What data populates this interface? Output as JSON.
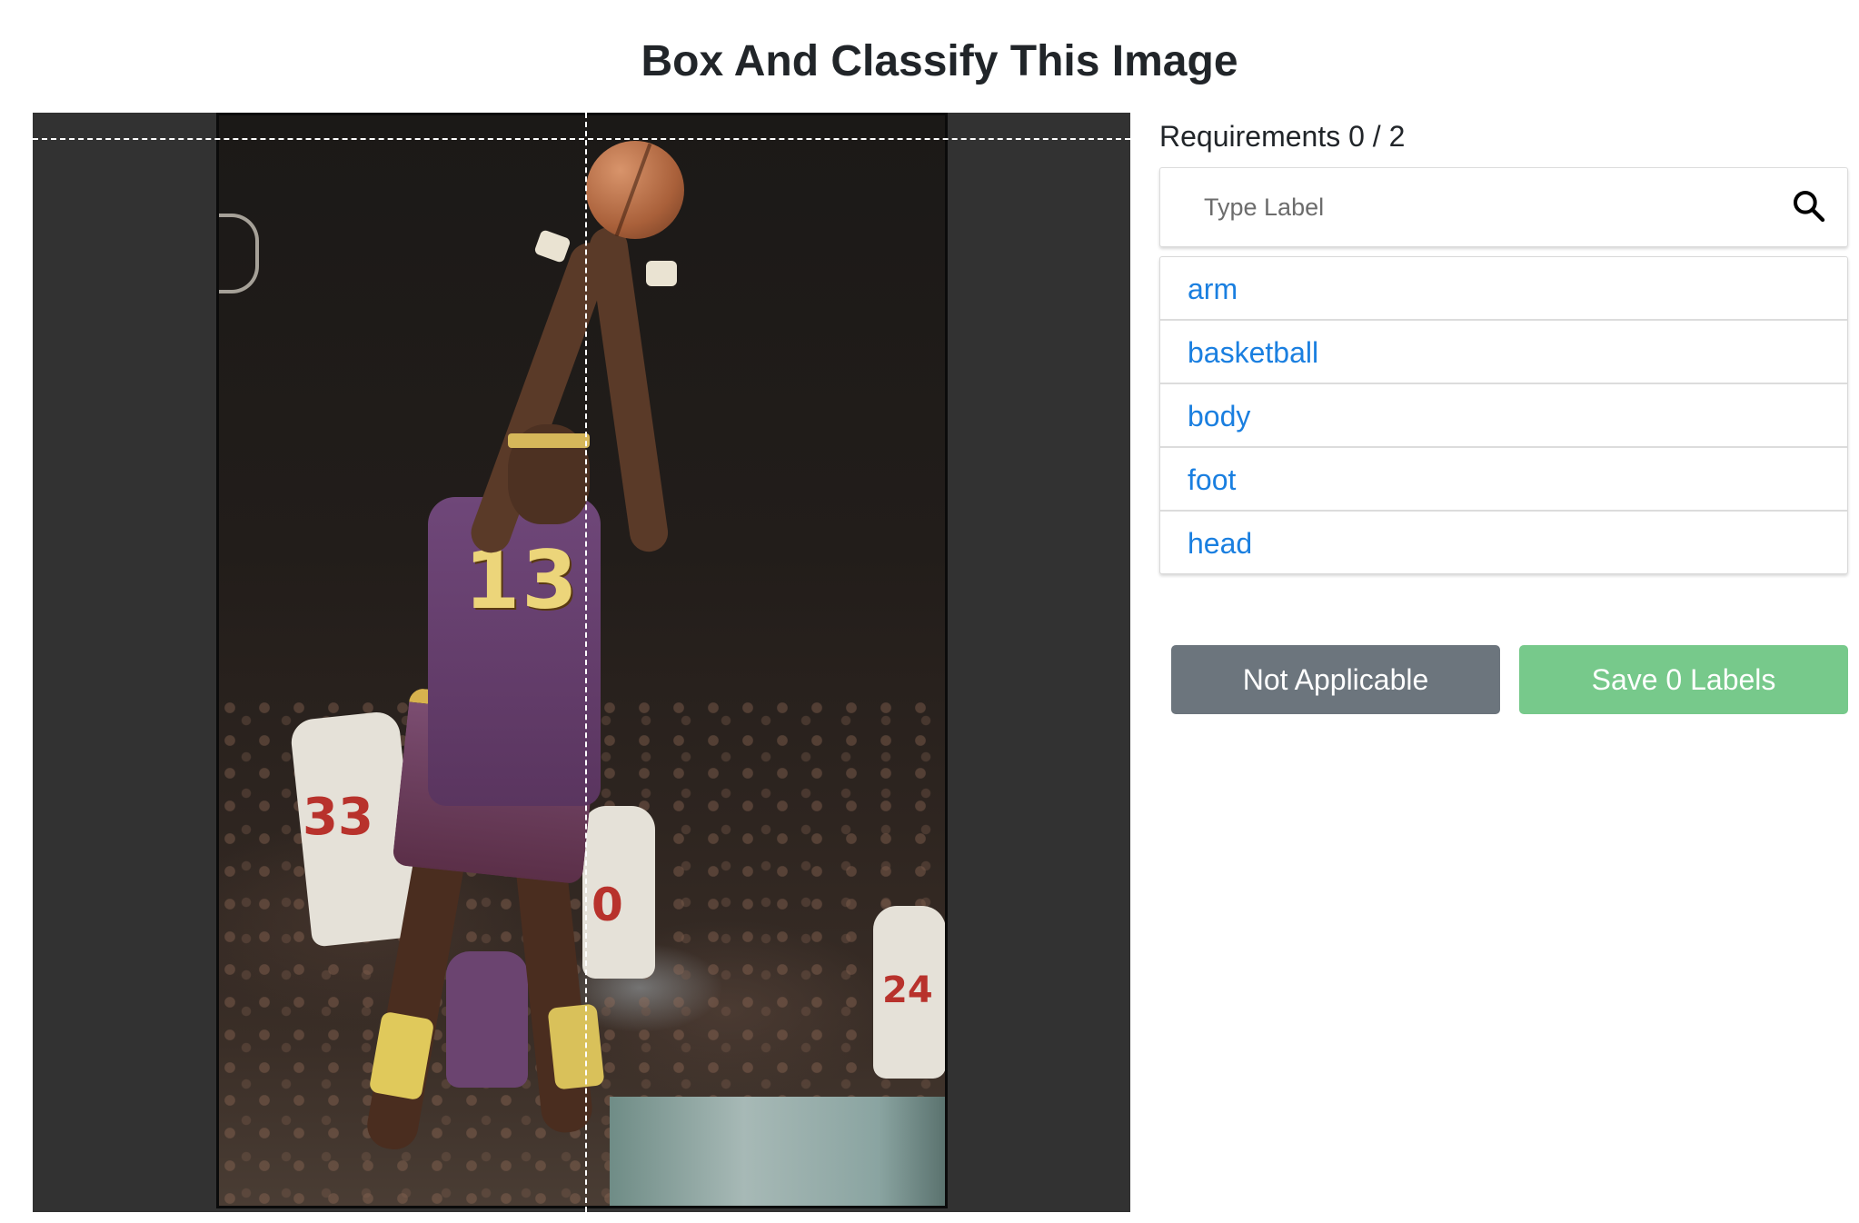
{
  "page": {
    "title": "Box And Classify This Image"
  },
  "canvas": {
    "image": {
      "jersey_number": "13",
      "opponent_numbers": [
        "33",
        "0",
        "24"
      ]
    }
  },
  "panel": {
    "requirements": "Requirements 0 / 2",
    "search": {
      "placeholder": "Type Label",
      "value": ""
    },
    "labels": [
      {
        "label": "arm"
      },
      {
        "label": "basketball"
      },
      {
        "label": "body"
      },
      {
        "label": "foot"
      },
      {
        "label": "head"
      }
    ],
    "buttons": {
      "not_applicable": "Not Applicable",
      "save": "Save 0 Labels"
    }
  },
  "colors": {
    "label_link": "#1a7fe0",
    "not_applicable_bg": "#6c757d",
    "save_bg": "#77c98b",
    "canvas_bg": "#323232"
  },
  "icons": {
    "search": "search-icon"
  }
}
